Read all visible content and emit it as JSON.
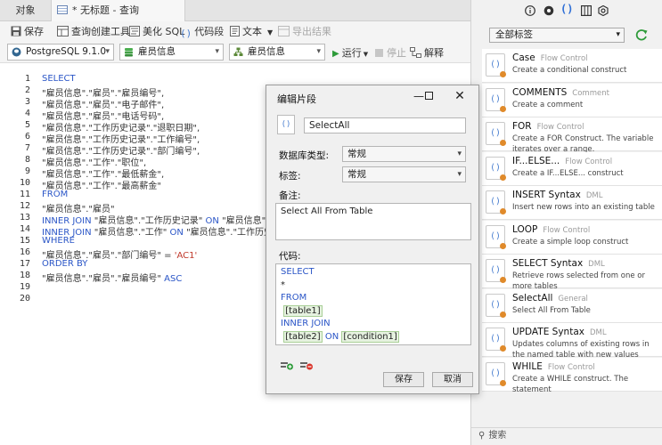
{
  "tabs": {
    "objects": "对象",
    "query": "* 无标题 - 查询"
  },
  "toolbar1": {
    "save": "保存",
    "query_builder": "查询创建工具",
    "beautify": "美化 SQL",
    "code_snippet": "代码段",
    "text": "文本",
    "export": "导出结果"
  },
  "toolbar2": {
    "connection": "PostgreSQL 9.1.0",
    "database": "雇员信息",
    "schema": "雇员信息",
    "run": "运行",
    "stop": "停止",
    "explain": "解释"
  },
  "editor": {
    "line_numbers": [
      "1",
      "2",
      "3",
      "4",
      "5",
      "6",
      "7",
      "8",
      "9",
      "10",
      "11",
      "12",
      "13",
      "14",
      "15",
      "16",
      "17",
      "18",
      "19",
      "20"
    ],
    "lines": [
      [
        {
          "t": "SELECT",
          "c": "kw"
        }
      ],
      [
        {
          "t": "\"雇员信息\".\"雇员\".\"雇员编号\","
        }
      ],
      [
        {
          "t": "\"雇员信息\".\"雇员\".\"电子邮件\","
        }
      ],
      [
        {
          "t": "\"雇员信息\".\"雇员\".\"电话号码\","
        }
      ],
      [
        {
          "t": "\"雇员信息\".\"工作历史记录\".\"退职日期\","
        }
      ],
      [
        {
          "t": "\"雇员信息\".\"工作历史记录\".\"工作编号\","
        }
      ],
      [
        {
          "t": "\"雇员信息\".\"工作历史记录\".\"部门编号\","
        }
      ],
      [
        {
          "t": "\"雇员信息\".\"工作\".\"职位\","
        }
      ],
      [
        {
          "t": "\"雇员信息\".\"工作\".\"最低薪金\","
        }
      ],
      [
        {
          "t": "\"雇员信息\".\"工作\".\"最高薪金\""
        }
      ],
      [
        {
          "t": "FROM",
          "c": "kw"
        }
      ],
      [
        {
          "t": "\"雇员信息\".\"雇员\""
        }
      ],
      [
        {
          "t": "INNER JOIN",
          "c": "kw"
        },
        {
          "t": " \"雇员信息\".\"工作历史记录\" "
        },
        {
          "t": "ON",
          "c": "kw"
        },
        {
          "t": " \"雇员信息\".\"工作"
        }
      ],
      [
        {
          "t": "INNER JOIN",
          "c": "kw"
        },
        {
          "t": " \"雇员信息\".\"工作\" "
        },
        {
          "t": "ON",
          "c": "kw"
        },
        {
          "t": " \"雇员信息\".\"工作历史记录"
        }
      ],
      [
        {
          "t": "WHERE",
          "c": "kw"
        }
      ],
      [
        {
          "t": "\"雇员信息\".\"雇员\".\"部门编号\" = "
        },
        {
          "t": "'AC1'",
          "c": "str"
        }
      ],
      [
        {
          "t": "ORDER BY",
          "c": "kw"
        }
      ],
      [
        {
          "t": "\"雇员信息\".\"雇员\".\"雇员编号\" "
        },
        {
          "t": "ASC",
          "c": "kw"
        }
      ],
      [],
      []
    ]
  },
  "right_panel": {
    "filter": "全部标签",
    "search_placeholder": "搜索",
    "snippets": [
      {
        "name": "Case",
        "category": "Flow Control",
        "desc": "Create a conditional construct"
      },
      {
        "name": "COMMENTS",
        "category": "Comment",
        "desc": "Create a comment"
      },
      {
        "name": "FOR",
        "category": "Flow Control",
        "desc": "Create a FOR Construct. The variable iterates over a range."
      },
      {
        "name": "IF...ELSE...",
        "category": "Flow Control",
        "desc": "Create a IF...ELSE... construct"
      },
      {
        "name": "INSERT Syntax",
        "category": "DML",
        "desc": "Insert new rows into an existing table"
      },
      {
        "name": "LOOP",
        "category": "Flow Control",
        "desc": "Create a simple loop construct"
      },
      {
        "name": "SELECT Syntax",
        "category": "DML",
        "desc": "Retrieve rows selected from one or more tables"
      },
      {
        "name": "SelectAll",
        "category": "General",
        "desc": "Select All From Table"
      },
      {
        "name": "UPDATE Syntax",
        "category": "DML",
        "desc": "Updates columns of existing rows in the named table with new values"
      },
      {
        "name": "WHILE",
        "category": "Flow Control",
        "desc": "Create a WHILE construct. The statement"
      }
    ]
  },
  "dialog": {
    "title": "编辑片段",
    "name": "SelectAll",
    "db_type_label": "数据库类型:",
    "db_type_value": "常规",
    "tag_label": "标签:",
    "tag_value": "常规",
    "remarks_label": "备注:",
    "remarks_value": "Select All From Table",
    "code_label": "代码:",
    "code": {
      "select": "SELECT",
      "star": "*",
      "from": "FROM",
      "table1": "[table1]",
      "inner_join": "INNER JOIN",
      "table2": "[table2]",
      "on": "ON",
      "condition1": "[condition1]"
    },
    "save": "保存",
    "cancel": "取消"
  },
  "colors": {
    "keyword": "#2b56c7",
    "string": "#c0392b",
    "accent": "#4a7fd0",
    "placeholder_bg": "#e6f2e0"
  }
}
